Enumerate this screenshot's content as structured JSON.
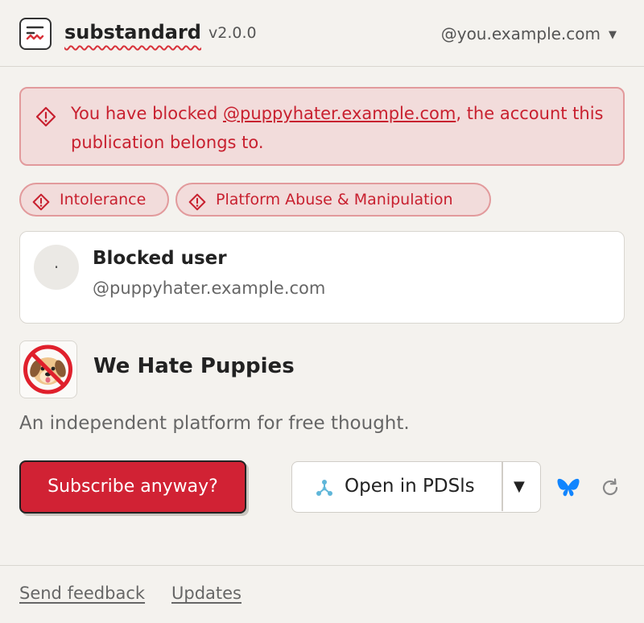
{
  "header": {
    "app_name": "substandard",
    "version": "v2.0.0",
    "account": "@you.example.com"
  },
  "alert": {
    "prefix": "You have blocked ",
    "link": "@puppyhater.example.com",
    "suffix": ", the account this publication belongs to."
  },
  "labels": [
    "Intolerance",
    "Platform Abuse & Manipulation"
  ],
  "author": {
    "avatar_glyph": "·",
    "name": "Blocked user",
    "handle": "@puppyhater.example.com"
  },
  "publication": {
    "title": "We Hate Puppies",
    "description": "An independent platform for free thought."
  },
  "actions": {
    "subscribe": "Subscribe anyway?",
    "open_in": "Open in PDSls",
    "dropdown": "▼"
  },
  "footer": {
    "feedback": "Send feedback",
    "updates": "Updates"
  },
  "colors": {
    "background": "#f4f2ee",
    "danger": "#d12234",
    "danger_bg": "#f2dcdb",
    "bluesky": "#1185fe"
  },
  "icons": [
    "app-logo-icon",
    "warning-diamond-icon",
    "no-puppies-icon",
    "pdsls-tree-icon",
    "bluesky-butterfly-icon",
    "refresh-icon",
    "chevron-down-icon"
  ]
}
